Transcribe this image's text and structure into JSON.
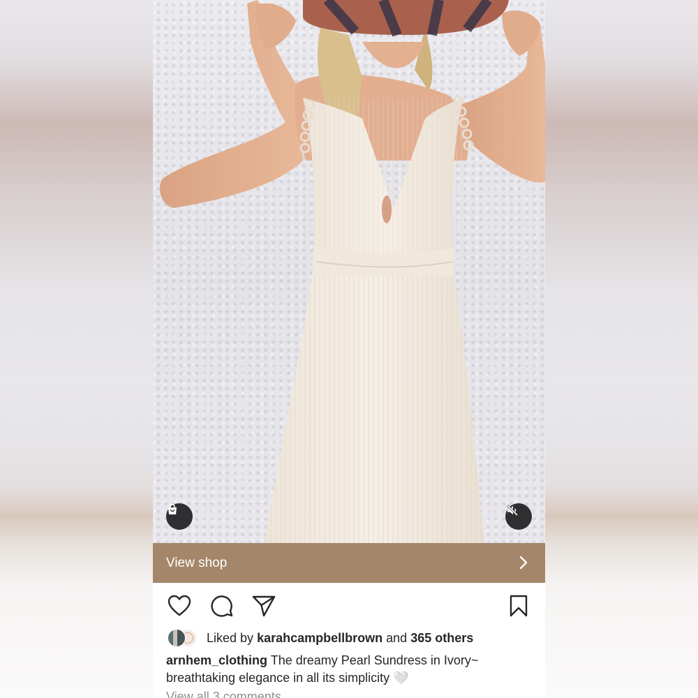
{
  "post": {
    "shop_bar_label": "View shop",
    "likes": {
      "prefix": "Liked by",
      "liker": "karahcampbellbrown",
      "joiner": "and",
      "others": "365 others"
    },
    "caption": {
      "username": "arnhem_clothing",
      "text": "The dreamy Pearl Sundress in Ivory~ breathtaking elegance in all its simplicity 🤍"
    },
    "view_comments": "View all 3 comments"
  },
  "icons": {
    "shop": "shopping-bag-icon",
    "mute": "speaker-muted-icon",
    "chevron": "chevron-right-icon",
    "like": "heart-icon",
    "comment": "comment-bubble-icon",
    "share": "paper-plane-icon",
    "save": "bookmark-icon"
  },
  "colors": {
    "shop_bar": "#a4866a",
    "text": "#262626",
    "muted_text": "#8e8e8e"
  }
}
